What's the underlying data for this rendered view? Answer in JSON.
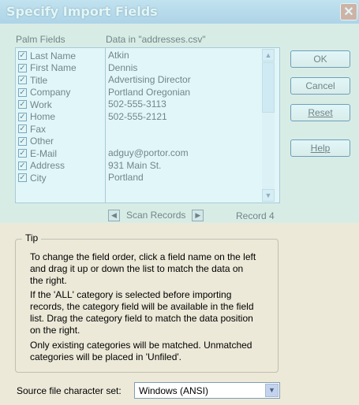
{
  "dialog": {
    "title": "Specify Import Fields",
    "close_glyph": "✕"
  },
  "headers": {
    "palm_fields": "Palm Fields",
    "data_in": "Data in \"addresses.csv\""
  },
  "fields": [
    {
      "label": "Last Name",
      "checked": true
    },
    {
      "label": "First Name",
      "checked": true
    },
    {
      "label": "Title",
      "checked": true
    },
    {
      "label": "Company",
      "checked": true
    },
    {
      "label": "Work",
      "checked": true
    },
    {
      "label": "Home",
      "checked": true
    },
    {
      "label": "Fax",
      "checked": true
    },
    {
      "label": "Other",
      "checked": true
    },
    {
      "label": "E-Mail",
      "checked": true
    },
    {
      "label": "Address",
      "checked": true
    },
    {
      "label": "City",
      "checked": true
    }
  ],
  "values": [
    "Atkin",
    "Dennis",
    "Advertising Director",
    "Portland Oregonian",
    "502-555-3113",
    "502-555-2121",
    "",
    "",
    "adguy@portor.com",
    "931 Main St.",
    "Portland"
  ],
  "buttons": {
    "ok": "OK",
    "cancel": "Cancel",
    "reset": "Reset",
    "help": "Help"
  },
  "nav": {
    "label": "Scan Records",
    "record": "Record 4"
  },
  "tip": {
    "legend": "Tip",
    "para1": "To change the field order, click a field name on the left and drag it up or down the list to match the data on the right.",
    "para2": "If the 'ALL' category is selected before importing records,  the category field will be available in the field list.  Drag the category field to match the data position on the right.",
    "para3": "Only existing categories will be matched. Unmatched categories will be placed in 'Unfiled'."
  },
  "charset": {
    "label": "Source file character set:",
    "value": "Windows (ANSI)"
  },
  "colors": {
    "title_bar": "#8db3da",
    "overlay": "#c8eef3"
  }
}
